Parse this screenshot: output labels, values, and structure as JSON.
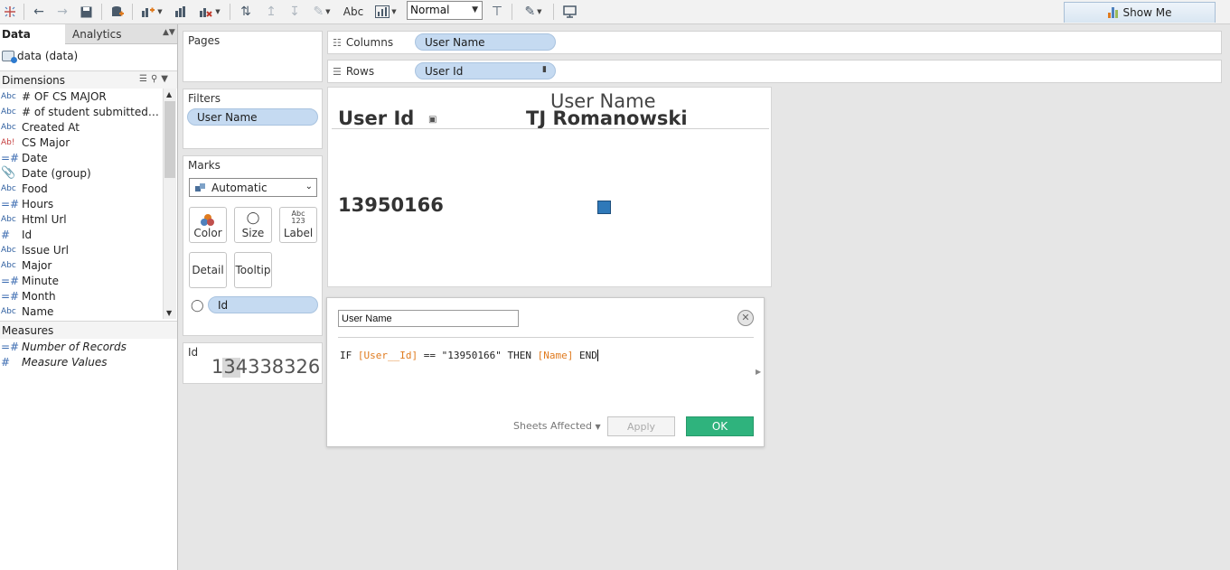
{
  "toolbar": {
    "fit_value": "Normal",
    "abc_label": "Abc",
    "show_me_label": "Show Me",
    "colors": {
      "accent": "#4a5a6a"
    }
  },
  "datapane": {
    "tab_data": "Data",
    "tab_analytics": "Analytics",
    "datasource": "data (data)",
    "dimensions_label": "Dimensions",
    "measures_label": "Measures",
    "dimensions": [
      {
        "type": "Abc",
        "name": "# OF CS MAJOR"
      },
      {
        "type": "Abc",
        "name": "# of student submitted aft..."
      },
      {
        "type": "Abc",
        "name": "Created At"
      },
      {
        "type": "Abc",
        "name": "CS Major"
      },
      {
        "type": "#",
        "name": "Date"
      },
      {
        "type": "group",
        "name": "Date (group)"
      },
      {
        "type": "Abc",
        "name": "Food"
      },
      {
        "type": "#",
        "name": "Hours"
      },
      {
        "type": "Abc",
        "name": "Html Url"
      },
      {
        "type": "#",
        "name": "Id"
      },
      {
        "type": "Abc",
        "name": "Issue Url"
      },
      {
        "type": "Abc",
        "name": "Major"
      },
      {
        "type": "#",
        "name": "Minute"
      },
      {
        "type": "#",
        "name": "Month"
      },
      {
        "type": "Abc",
        "name": "Name"
      }
    ],
    "measures": [
      {
        "type": "#",
        "name": "Number of Records"
      },
      {
        "type": "#",
        "name": "Measure Values"
      }
    ]
  },
  "cards": {
    "pages_label": "Pages",
    "filters_label": "Filters",
    "filter_pill": "User Name",
    "marks_label": "Marks",
    "mark_type": "Automatic",
    "color_label": "Color",
    "size_label": "Size",
    "label_label": "Label",
    "label_icon_top": "Abc",
    "label_icon_bottom": "123",
    "detail_label": "Detail",
    "tooltip_label": "Tooltip",
    "mark_pill": "Id",
    "id_card_label": "Id",
    "id_card_value": "134338326"
  },
  "shelves": {
    "columns_label": "Columns",
    "rows_label": "Rows",
    "columns_pill": "User Name",
    "rows_pill": "User Id"
  },
  "view": {
    "column_header": "User Name",
    "column_value": "TJ Romanowski",
    "row_header": "User Id",
    "row_value": "13950166",
    "mark_color": "#2f79b9"
  },
  "calc_editor": {
    "name": "User Name",
    "formula": {
      "kw_if": "IF",
      "field1": "[User__Id]",
      "op": "==",
      "literal": "\"13950166\"",
      "kw_then": "THEN",
      "field2": "[Name]",
      "kw_end": "END"
    },
    "sheets_affected": "Sheets Affected",
    "apply_label": "Apply",
    "ok_label": "OK",
    "ok_color": "#2fb37d"
  }
}
